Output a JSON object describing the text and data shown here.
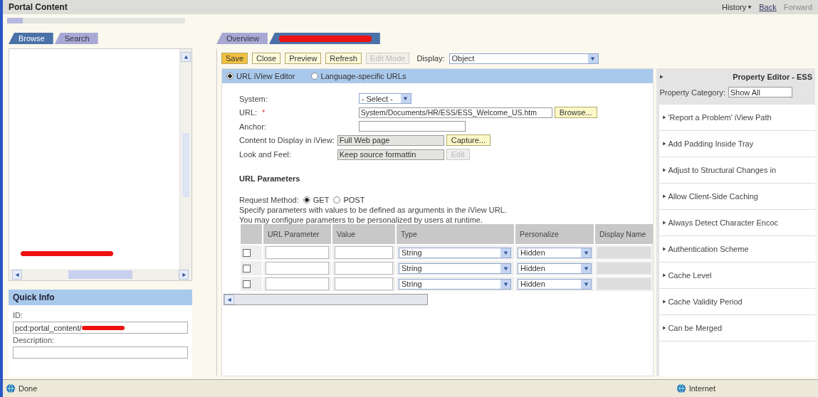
{
  "header": {
    "title": "Portal Content",
    "history": "History",
    "back": "Back",
    "forward": "Forward"
  },
  "left_tabs": [
    {
      "label": "Browse",
      "selected": true
    },
    {
      "label": "Search",
      "selected": false
    }
  ],
  "quick_info": {
    "title": "Quick Info",
    "id_label": "ID:",
    "id_value": "pcd:portal_content/",
    "description_label": "Description:"
  },
  "editor_tabs": [
    {
      "kind": "text",
      "label": "Overview",
      "selected": false
    },
    {
      "kind": "redacted",
      "selected": true
    }
  ],
  "toolbar": {
    "buttons": [
      {
        "label": "Save",
        "highlighted": true,
        "disabled": false
      },
      {
        "label": "Close",
        "highlighted": false,
        "disabled": false
      },
      {
        "label": "Preview",
        "highlighted": false,
        "disabled": false
      },
      {
        "label": "Refresh",
        "highlighted": false,
        "disabled": false
      },
      {
        "label": "Edit Mode",
        "highlighted": false,
        "disabled": true
      }
    ],
    "display_label": "Display:",
    "display_value": "Object"
  },
  "modes": [
    {
      "label": "URL iView Editor",
      "selected": true
    },
    {
      "label": "Language-specific URLs",
      "selected": false
    }
  ],
  "form": {
    "system_label": "System:",
    "system_value": "- Select -",
    "url_label": "URL:",
    "url_required_mark": "*",
    "url_value": "System/Documents/HR/ESS/ESS_Welcome_US.htm",
    "browse": "Browse...",
    "anchor_label": "Anchor:",
    "content_label": "Content to Display in iView:",
    "content_value": "Full Web page",
    "capture": "Capture...",
    "look_label": "Look and Feel:",
    "look_value": "Keep source formattin",
    "edit": "Edit",
    "edit_disabled": true
  },
  "url_parameters": {
    "title": "URL Parameters",
    "method_label": "Request Method:",
    "methods": [
      {
        "label": "GET",
        "selected": true
      },
      {
        "label": "POST",
        "selected": false
      }
    ],
    "notes": [
      "Specify parameters with values to be defined as arguments in the iView URL.",
      "You may configure parameters to be personalized by users at runtime."
    ],
    "columns": [
      "URL Parameter",
      "Value",
      "Type",
      "Personalize",
      "Display Name"
    ],
    "rows": [
      {
        "checked": false,
        "type": "String",
        "personalize": "Hidden"
      },
      {
        "checked": false,
        "type": "String",
        "personalize": "Hidden"
      },
      {
        "checked": false,
        "type": "String",
        "personalize": "Hidden"
      }
    ]
  },
  "property_editor": {
    "title": "Property Editor - ESS",
    "category_label": "Property Category:",
    "category_value": "Show All",
    "items": [
      "'Report a Problem' iView Path",
      "Add Padding Inside Tray",
      "Adjust to Structural Changes in",
      "Allow Client-Side Caching",
      "Always Detect Character Encoc",
      "Authentication Scheme",
      "Cache Level",
      "Cache Validity Period",
      "Can be Merged"
    ]
  },
  "status_bar": {
    "text": "Done",
    "zone": "Internet"
  }
}
